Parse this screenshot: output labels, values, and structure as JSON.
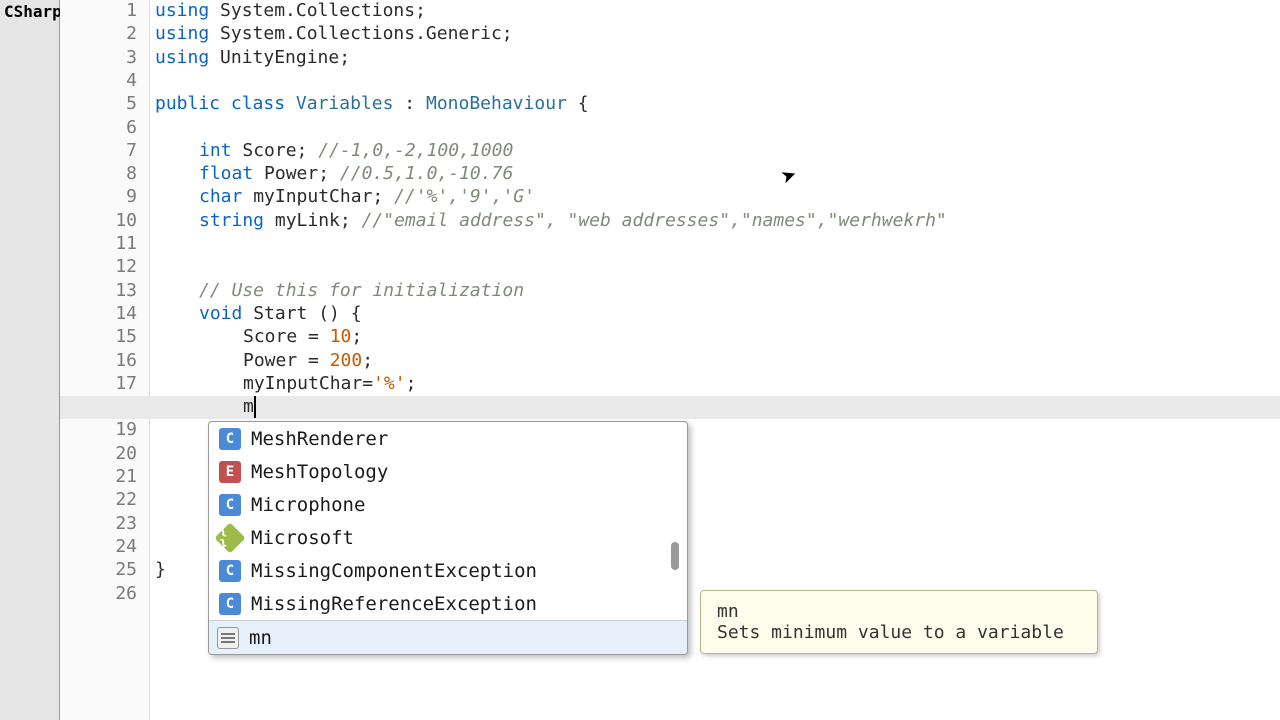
{
  "left_tab": "CSharp",
  "line_height": 23.3,
  "lines": 26,
  "code": {
    "l1": {
      "using": "using",
      "ns": "System.Collections",
      "sc": ";"
    },
    "l2": {
      "using": "using",
      "ns": "System.Collections.Generic",
      "sc": ";"
    },
    "l3": {
      "using": "using",
      "ns": "UnityEngine",
      "sc": ";"
    },
    "l5a": "public",
    "l5b": "class",
    "l5c": "Variables",
    "l5d": ":",
    "l5e": "MonoBehaviour",
    "l5f": " {",
    "l7a": "int",
    "l7b": " Score; ",
    "l7c": "//-1,0,-2,100,1000",
    "l8a": "float",
    "l8b": " Power; ",
    "l8c": "//0.5,1.0,-10.76",
    "l9a": "char",
    "l9b": " myInputChar; ",
    "l9c": "//'%','9','G'",
    "l10a": "string",
    "l10b": " myLink; ",
    "l10c": "//\"email address\", \"web addresses\",\"names\",\"werhwekrh\"",
    "l13": "// Use this for initialization",
    "l14a": "void",
    "l14b": " Start () {",
    "l15a": "Score = ",
    "l15b": "10",
    "l15c": ";",
    "l16a": "Power = ",
    "l16b": "200",
    "l16c": ";",
    "l17a": "myInputChar=",
    "l17b": "'%'",
    "l17c": ";",
    "l18": "m",
    "l25": "}"
  },
  "autocomplete": {
    "items": [
      {
        "icon": "C",
        "label": "MeshRenderer"
      },
      {
        "icon": "E",
        "label": "MeshTopology"
      },
      {
        "icon": "C",
        "label": "Microphone"
      },
      {
        "icon": "N",
        "label": "Microsoft"
      },
      {
        "icon": "C",
        "label": "MissingComponentException"
      },
      {
        "icon": "C",
        "label": "MissingReferenceException"
      }
    ],
    "selected": {
      "icon": "T",
      "label": "mn"
    }
  },
  "tooltip": {
    "title": "mn",
    "desc": "Sets minimum value to a variable"
  }
}
